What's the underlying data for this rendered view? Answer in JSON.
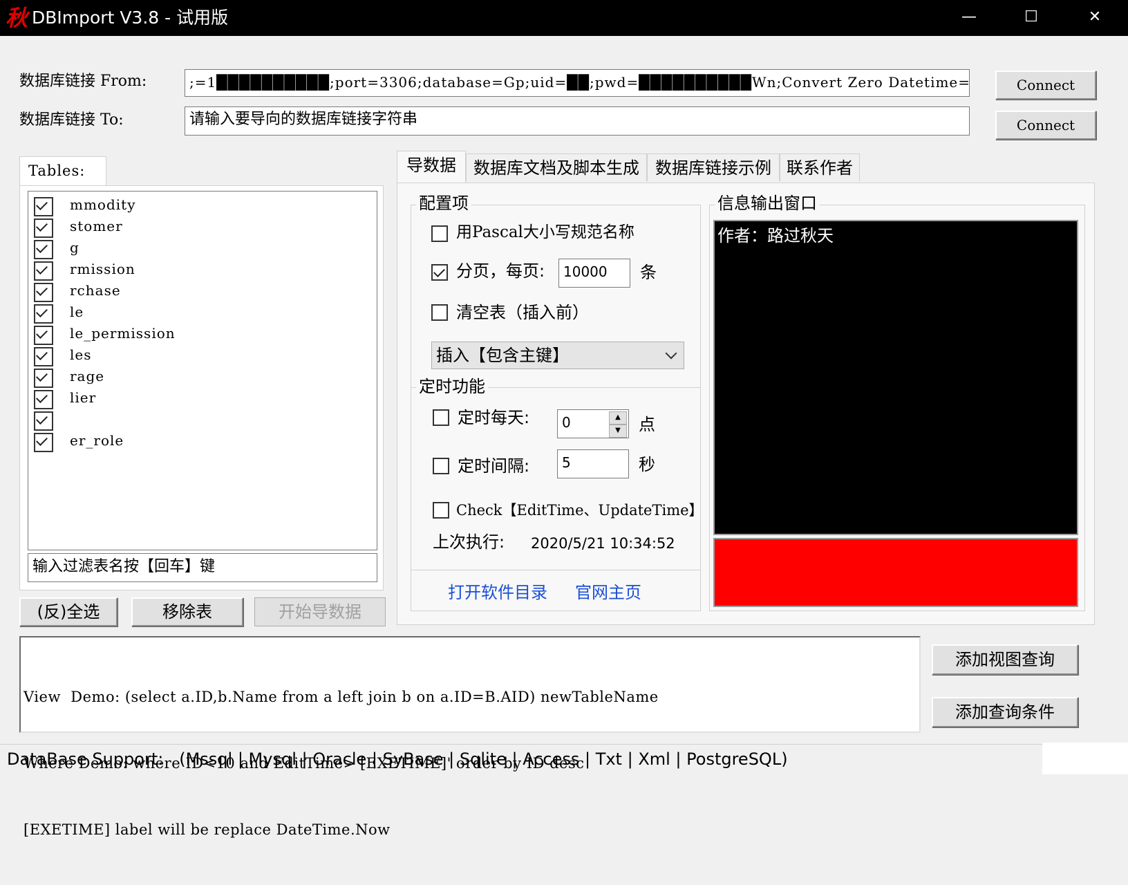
{
  "window": {
    "icon_glyph": "秋",
    "title": "DBImport V3.8 - 试用版",
    "minimize_glyph": "—",
    "maximize_glyph": "☐",
    "close_glyph": "✕"
  },
  "connection": {
    "from_label": "数据库链接 From:",
    "from_value": ";=1██████████;port=3306;database=Gp;uid=██;pwd=██████████Wn;Convert Zero Datetime=True;",
    "to_label": "数据库链接 To:",
    "to_placeholder": "请输入要导向的数据库链接字符串",
    "connect_label": "Connect"
  },
  "tables_panel": {
    "tab_label": "Tables:",
    "items": [
      {
        "name": "mmodity",
        "checked": true
      },
      {
        "name": "stomer",
        "checked": true
      },
      {
        "name": "g",
        "checked": true
      },
      {
        "name": "rmission",
        "checked": true
      },
      {
        "name": "rchase",
        "checked": true
      },
      {
        "name": "le",
        "checked": true
      },
      {
        "name": "le_permission",
        "checked": true
      },
      {
        "name": "les",
        "checked": true
      },
      {
        "name": "rage",
        "checked": true
      },
      {
        "name": "lier",
        "checked": true
      },
      {
        "name": "",
        "checked": true
      },
      {
        "name": "er_role",
        "checked": true
      }
    ],
    "filter_placeholder": "输入过滤表名按【回车】键",
    "select_all_label": "(反)全选",
    "remove_label": "移除表",
    "start_label": "开始导数据"
  },
  "tabs": [
    {
      "label": "导数据",
      "active": true
    },
    {
      "label": "数据库文档及脚本生成",
      "active": false
    },
    {
      "label": "数据库链接示例",
      "active": false
    },
    {
      "label": "联系作者",
      "active": false
    }
  ],
  "config": {
    "group_title": "配置项",
    "pascal_label": "用Pascal大小写规范名称",
    "pascal_checked": false,
    "paging_label": "分页，每页:",
    "paging_checked": true,
    "page_size": "10000",
    "page_unit": "条",
    "truncate_label": "清空表（插入前）",
    "truncate_checked": false,
    "insert_mode": "插入【包含主键】"
  },
  "timer": {
    "group_title": "定时功能",
    "daily_label": "定时每天:",
    "daily_checked": false,
    "daily_value": "0",
    "daily_unit": "点",
    "interval_label": "定时间隔:",
    "interval_checked": false,
    "interval_value": "5",
    "interval_unit": "秒",
    "check_label": "Check【EditTime、UpdateTime】",
    "check_checked": false,
    "last_run_label": "上次执行:",
    "last_run_value": "2020/5/21 10:34:52"
  },
  "links": {
    "open_dir": "打开软件目录",
    "homepage": "官网主页"
  },
  "output": {
    "group_title": "信息输出窗口",
    "text": "作者：路过秋天",
    "status_color": "#ff0000"
  },
  "query": {
    "lines": [
      "View  Demo: (select a.ID,b.Name from a left join b on a.ID=B.AID) newTableName",
      "Where Demo: where ID<10 and EditTime>'[EXETIME]' order by ID desc",
      "[EXETIME] label will be replace DateTime.Now"
    ],
    "add_view_label": "添加视图查询",
    "add_condition_label": "添加查询条件"
  },
  "status": {
    "text": "DataBase Support:   (Mssql | Mysql | Oracle | SyBase | Sqlite | Access | Txt | Xml | PostgreSQL)"
  }
}
